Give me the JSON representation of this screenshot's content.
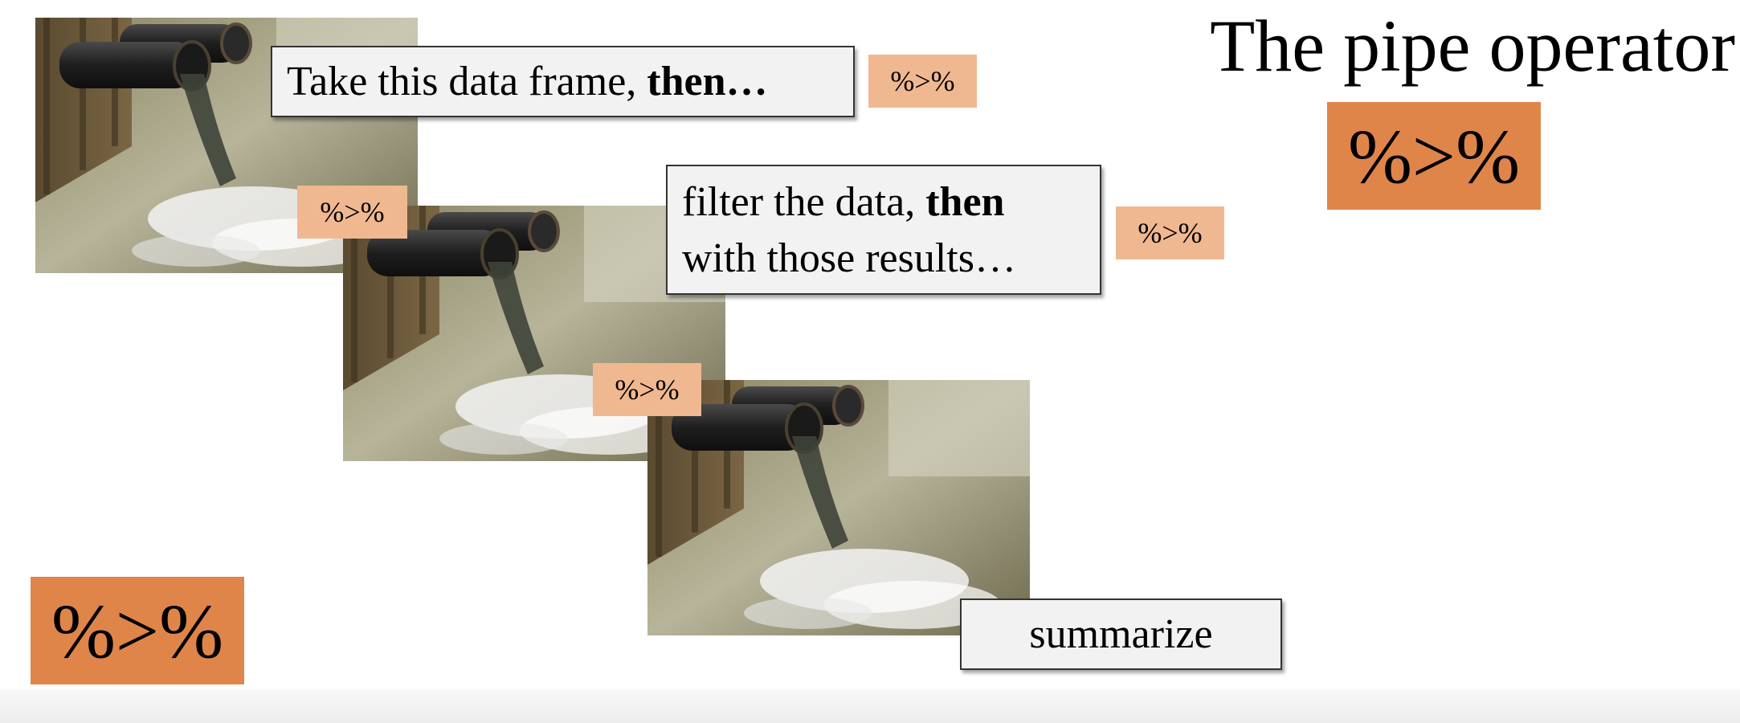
{
  "slide": {
    "title": "The pipe operator",
    "pipe_symbol": "%>%",
    "callouts": {
      "first": {
        "text": "Take this data frame, ",
        "bold": "then…"
      },
      "second": {
        "line1_text": "filter the data, ",
        "line1_bold": "then",
        "line2_text": "with those results…"
      },
      "third": {
        "text": "summarize"
      }
    },
    "photo": {
      "description_icon": "drainage-pipe-photo"
    }
  },
  "colors": {
    "badge": "#e0854a",
    "small_badge": "#f0b890",
    "callout_bg": "#f2f2f2"
  }
}
